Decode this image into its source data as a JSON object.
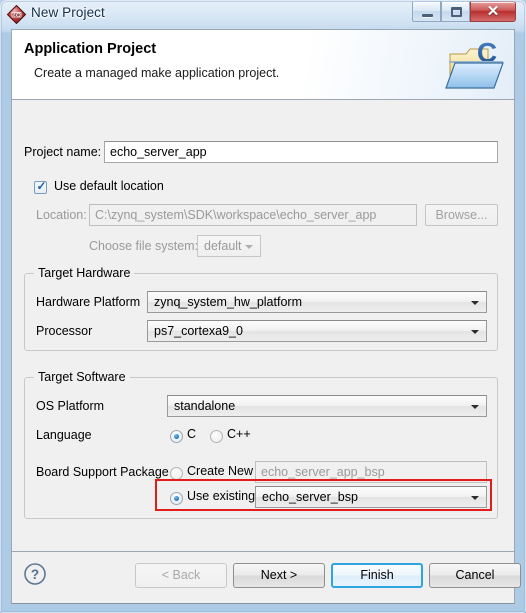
{
  "window": {
    "title": "New Project",
    "app_icon": "sdk-diamond-icon",
    "controls": {
      "minimize": "minimize-icon",
      "maximize": "restore-icon",
      "close_label": "✕"
    }
  },
  "header": {
    "title": "Application Project",
    "subtitle": "Create a managed make application project.",
    "icon": "c-project-folder-icon"
  },
  "form": {
    "project_name_label": "Project name:",
    "project_name_value": "echo_server_app",
    "use_default_location_label": "Use default location",
    "use_default_location_checked": true,
    "location_label": "Location:",
    "location_value": "C:\\zynq_system\\SDK\\workspace\\echo_server_app",
    "browse_label": "Browse...",
    "choose_file_system_label": "Choose file system:",
    "file_system_value": "default"
  },
  "target_hardware": {
    "group_title": "Target Hardware",
    "hardware_platform_label": "Hardware Platform",
    "hardware_platform_value": "zynq_system_hw_platform",
    "processor_label": "Processor",
    "processor_value": "ps7_cortexa9_0"
  },
  "target_software": {
    "group_title": "Target Software",
    "os_platform_label": "OS Platform",
    "os_platform_value": "standalone",
    "language_label": "Language",
    "language_c_label": "C",
    "language_cpp_label": "C++",
    "language_selected": "C",
    "bsp_label": "Board Support Package",
    "bsp_create_new_label": "Create New",
    "bsp_create_new_value": "echo_server_app_bsp",
    "bsp_use_existing_label": "Use existing",
    "bsp_use_existing_value": "echo_server_bsp",
    "bsp_selected": "Use existing"
  },
  "footer": {
    "help_icon": "help-icon",
    "back_label": "< Back",
    "back_enabled": false,
    "next_label": "Next >",
    "finish_label": "Finish",
    "cancel_label": "Cancel",
    "default_button": "Finish"
  },
  "colors": {
    "highlight_red": "#e21b1b",
    "default_button_blue": "#2ea5e0",
    "titlebar_text": "#11314f",
    "close_button_red": "#b93030"
  }
}
